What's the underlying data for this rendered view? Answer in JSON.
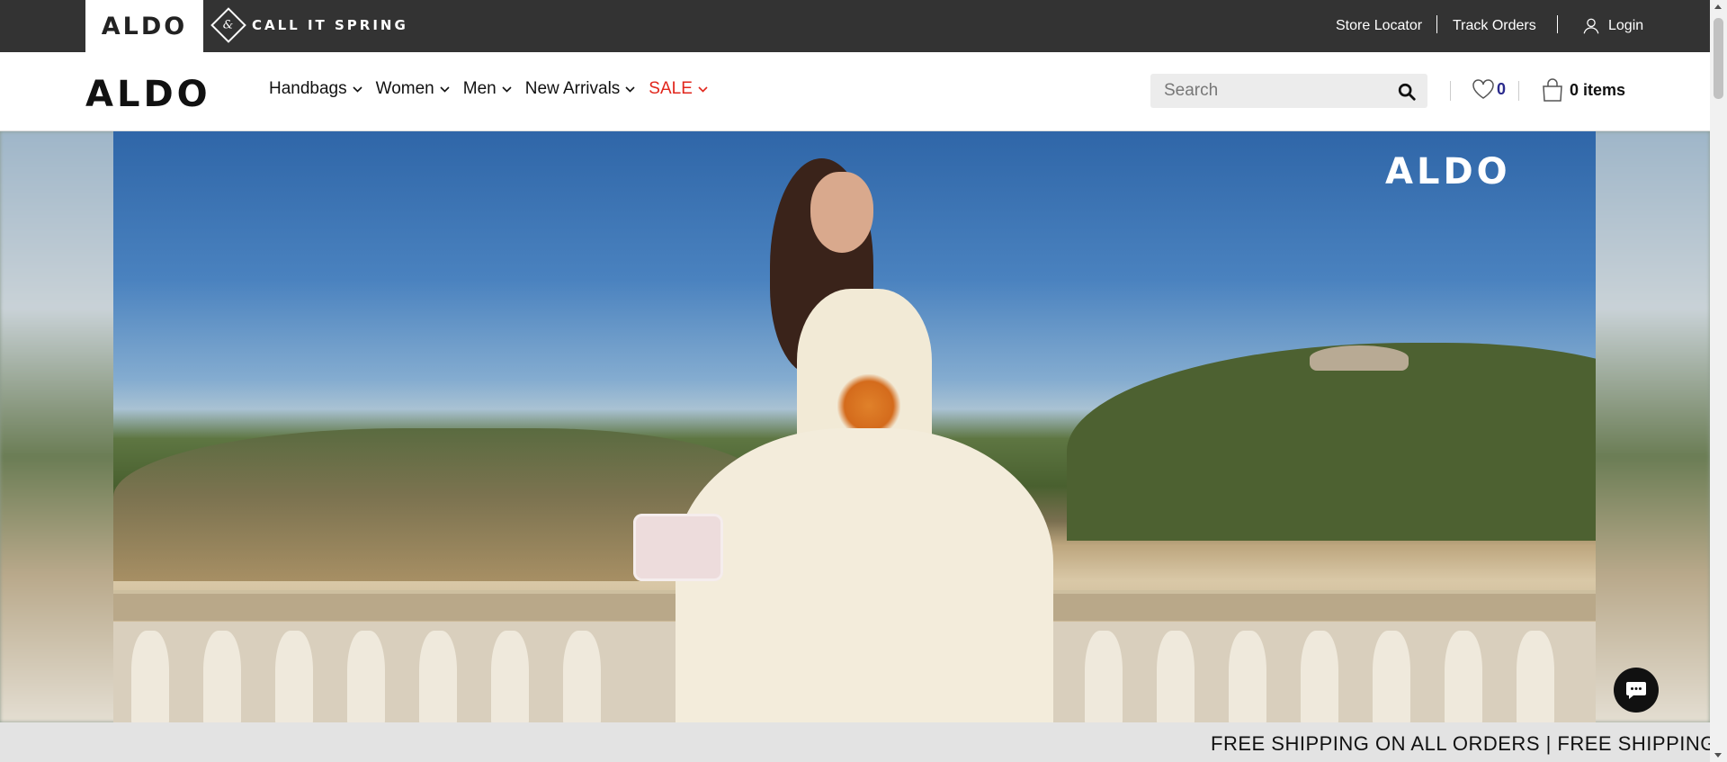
{
  "topbar": {
    "brand": "ALDO",
    "campaign": "CALL IT SPRING",
    "campaign_glyph": "&",
    "links": {
      "store_locator": "Store Locator",
      "track_orders": "Track Orders",
      "login": "Login"
    }
  },
  "header": {
    "logo": "ALDO",
    "menu": [
      {
        "label": "Handbags"
      },
      {
        "label": "Women"
      },
      {
        "label": "Men"
      },
      {
        "label": "New Arrivals"
      },
      {
        "label": "SALE",
        "color": "#e1261c"
      }
    ],
    "search": {
      "placeholder": "Search",
      "value": ""
    },
    "wishlist_count": "0",
    "cart_label": "0 items"
  },
  "hero": {
    "logo": "ALDO"
  },
  "ticker": {
    "text": "FREE SHIPPING ON ALL ORDERS | FREE SHIPPING ON"
  },
  "colors": {
    "topbar_bg": "#333333",
    "sale": "#e1261c",
    "wishlist_count": "#2a2a8c",
    "search_bg": "#ececec"
  },
  "icons": {
    "user": "user-icon",
    "search": "search-icon",
    "heart": "heart-icon",
    "bag": "shopping-bag-icon",
    "chat": "chat-icon",
    "chevron": "chevron-down-icon"
  }
}
